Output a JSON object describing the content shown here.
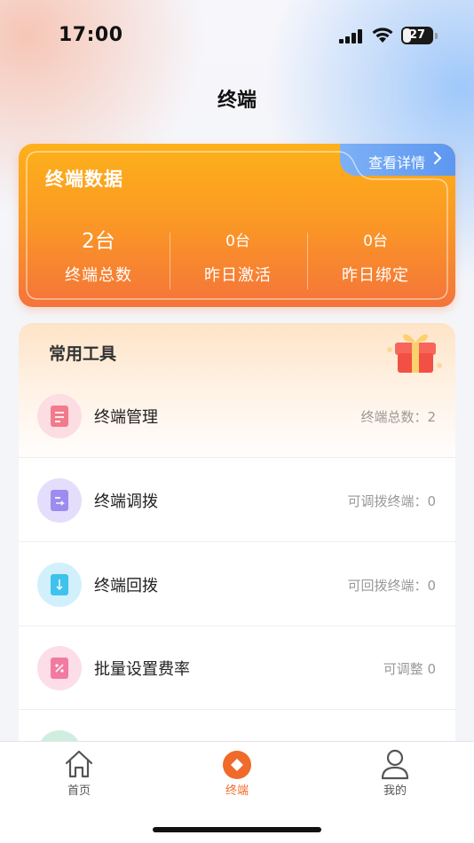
{
  "status_bar": {
    "time": "17:00",
    "battery": "27"
  },
  "page": {
    "title": "终端"
  },
  "data_card": {
    "title": "终端数据",
    "details_link": "查看详情",
    "stats": [
      {
        "value": "2台",
        "label": "终端总数"
      },
      {
        "value": "0台",
        "label": "昨日激活"
      },
      {
        "value": "0台",
        "label": "昨日绑定"
      }
    ]
  },
  "tools": {
    "title": "常用工具",
    "items": [
      {
        "name": "终端管理",
        "meta": "终端总数：2",
        "icon": "document-icon",
        "color": "#f27a8a"
      },
      {
        "name": "终端调拨",
        "meta": "可调拨终端：0",
        "icon": "transfer-icon",
        "color": "#9c8cf0"
      },
      {
        "name": "终端回拨",
        "meta": "可回拨终端：0",
        "icon": "return-icon",
        "color": "#3ec2ee"
      },
      {
        "name": "批量设置费率",
        "meta": "可调整  0",
        "icon": "percent-icon",
        "color": "#f27aa0"
      }
    ]
  },
  "tab_bar": {
    "items": [
      {
        "label": "首页",
        "icon": "home-icon"
      },
      {
        "label": "终端",
        "icon": "terminal-icon"
      },
      {
        "label": "我的",
        "icon": "user-icon"
      }
    ],
    "active": "终端",
    "active_color": "#f06a2a"
  }
}
